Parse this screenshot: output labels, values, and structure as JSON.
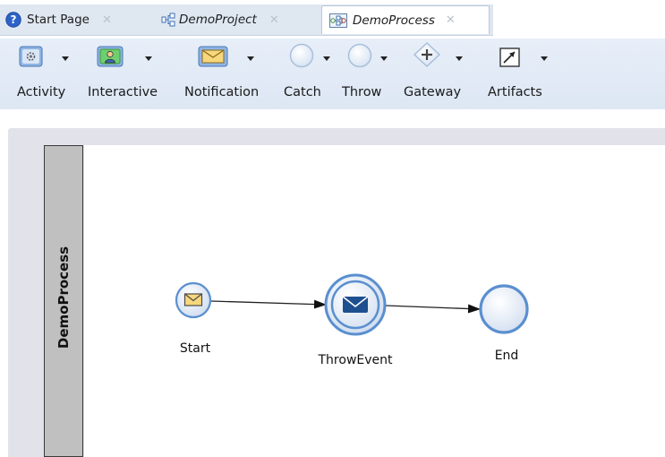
{
  "tabs": [
    {
      "label": "Start Page",
      "icon": "help-circle-icon",
      "italic": false
    },
    {
      "label": "DemoProject",
      "icon": "project-icon",
      "italic": true
    },
    {
      "label": "DemoProcess",
      "icon": "process-icon",
      "italic": true,
      "active": true
    }
  ],
  "toolbar": {
    "activity": "Activity",
    "interactive": "Interactive",
    "notification": "Notification",
    "catch": "Catch",
    "throw": "Throw",
    "gateway": "Gateway",
    "artifacts": "Artifacts"
  },
  "diagram": {
    "lane_title": "DemoProcess",
    "nodes": {
      "start": "Start",
      "throw_event": "ThrowEvent",
      "end": "End"
    }
  },
  "colors": {
    "accent": "#3f7bd6",
    "toolbar_bg": "#e2eaf6",
    "lane_header": "#c0c0c0"
  }
}
